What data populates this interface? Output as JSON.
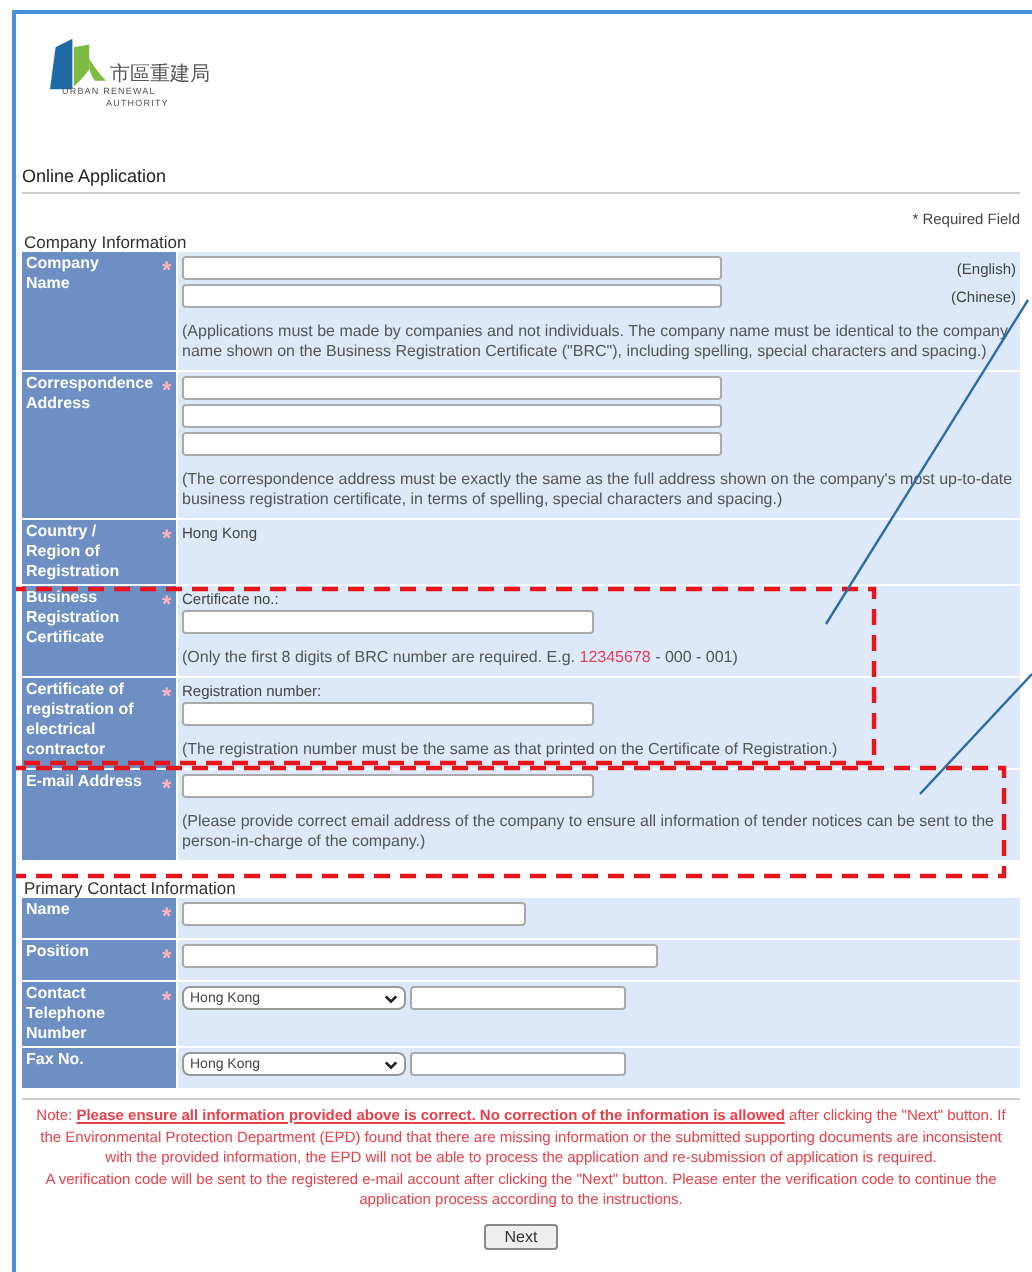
{
  "logo": {
    "chinese": "市區重建局",
    "english_1": "URBAN RENEWAL",
    "english_2": "AUTHORITY"
  },
  "page_title": "Online Application",
  "required_note": "* Required Field",
  "company_section": {
    "title": "Company Information",
    "rows": [
      {
        "label": "Company Name",
        "mark": "*",
        "kind": "bilingual",
        "inputs": [
          {
            "suffix": "(English)"
          },
          {
            "suffix": "(Chinese)"
          }
        ],
        "hint": [
          {
            "text": "(Applications must be made by companies and not individuals. The company name must be identical to the company name shown on the Business Registration Certificate (\"BRC\"), including spelling, special characters and spacing.)",
            "highlight": false
          }
        ]
      },
      {
        "label": "Correspondence Address",
        "mark": "*",
        "kind": "address",
        "hint": [
          {
            "text": "(The correspondence address must be exactly the same as the full address shown on the company's most up-to-date business registration certificate, in terms of spelling, special characters and spacing.)",
            "highlight": false
          }
        ]
      },
      {
        "label": "Country / Region of Registration",
        "mark": "*",
        "kind": "text",
        "value": "Hong Kong"
      },
      {
        "label": "Business Registration Certificate",
        "mark": "*",
        "kind": "single",
        "caption": "Certificate no.:",
        "hint": [
          {
            "text": "(Only the first 8 digits of BRC number are required. E.g. ",
            "highlight": false
          },
          {
            "text": "12345678",
            "highlight": true
          },
          {
            "text": " - 000 - 001)",
            "highlight": false
          }
        ]
      },
      {
        "label": "Certificate of registration of electrical contractor",
        "mark": "*",
        "kind": "single",
        "caption": "Registration number:",
        "hint": [
          {
            "text": "(The registration number must be the same as that printed on the Certificate of Registration.)",
            "highlight": false
          }
        ]
      },
      {
        "label": "E-mail Address",
        "mark": "*",
        "kind": "single",
        "hint": [
          {
            "text": "(Please provide correct email address of the company to ensure all information of tender notices can be sent to the person-in-charge of the company.)",
            "highlight": false
          }
        ]
      }
    ]
  },
  "contact_section": {
    "title": "Primary Contact Information",
    "rows": [
      {
        "label": "Name",
        "mark": "*",
        "kind": "single"
      },
      {
        "label": "Position",
        "mark": "*",
        "kind": "single"
      },
      {
        "label": "Contact Telephone Number",
        "mark": "*",
        "kind": "phone",
        "region": "Hong Kong"
      },
      {
        "label": "Fax No.",
        "kind": "phone",
        "region": "Hong Kong"
      }
    ]
  },
  "note": "Note: **Please ensure all information provided above is correct. No correction of the information is allowed** after clicking the \"Next\" button. If the Environmental Protection Department (EPD) found that there are missing information or the submitted supporting documents are inconsistent with the provided information, the EPD will not be able to process the application and re-submission of application is required.",
  "note_2": "A verification code will be sent to the registered e-mail account after clicking the \"Next\" button. Please enter the verification code to continue the application process according to the instructions.",
  "next_button": "Next"
}
